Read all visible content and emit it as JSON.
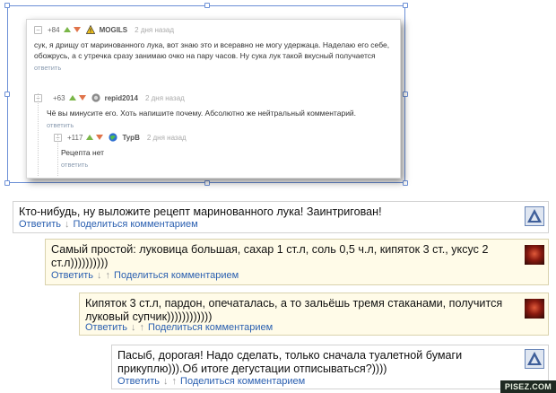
{
  "pikabu": {
    "comments": [
      {
        "rating": "+84",
        "author": "MOGILS",
        "date": "2 дня назад",
        "text": "сук, я дрищу от маринованного лука, вот знаю это и всеравно не могу удержаца. Наделаю его себе, обожрусь, а с утречка сразу занимаю очко на пару часов. Ну сука лук такой вкусный получается",
        "reply": "ответить",
        "icon": "warning-icon"
      },
      {
        "rating": "+63",
        "author": "repid2014",
        "date": "2 дня назад",
        "text": "Чё вы минусите его. Хоть напишите почему. Абсолютно же нейтральный комментарий.",
        "reply": "ответить",
        "icon": "avatar-gear-icon"
      },
      {
        "rating": "+117",
        "author": "TypB",
        "date": "2 дня назад",
        "text": "Рецепта нет",
        "reply": "ответить",
        "icon": "avatar-globe-icon"
      }
    ],
    "collapse_symbol": "−"
  },
  "forum": {
    "comments": [
      {
        "text": "Кто-нибудь, ну выложите рецепт маринованного лука! Заинтригован!",
        "reply": "Ответить",
        "share": "Поделиться комментарием",
        "has_up": false,
        "avatar": "blue-logo-avatar"
      },
      {
        "text": "Самый простой: луковица большая, сахар 1 ст.л, соль 0,5 ч.л, кипяток 3 ст., уксус 2 ст.л))))))))))",
        "reply": "Ответить",
        "share": "Поделиться комментарием",
        "has_up": true,
        "avatar": "red-avatar"
      },
      {
        "text": "Кипяток 3 ст.л, пардон, опечаталась, а то зальёшь тремя стаканами, получится луковый супчик))))))))))))",
        "reply": "Ответить",
        "share": "Поделиться комментарием",
        "has_up": true,
        "avatar": "red-avatar"
      },
      {
        "text": "Пасыб, дорогая! Надо сделать, только сначала туалетной бумаги прикуплю))).Об итоге дегустации отписываться?))))",
        "reply": "Ответить",
        "share": "Поделиться комментарием",
        "has_up": true,
        "avatar": "blue-logo-avatar"
      }
    ],
    "down_arrow": "↓",
    "up_arrow": "↑"
  },
  "watermark": "PISEZ.COM",
  "colors": {
    "link": "#2a5fb0",
    "highlight_bg": "#fffbe8",
    "up_arrow": "#7ab648",
    "down_arrow": "#e0734a",
    "selection": "#6b8fd6"
  }
}
